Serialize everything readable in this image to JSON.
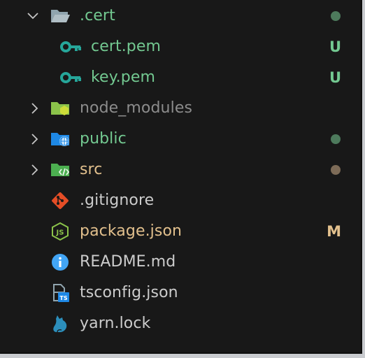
{
  "colors": {
    "background": "#181818",
    "untracked": "#73c991",
    "modified": "#e2c08d",
    "ignored": "#8c8c8c",
    "default": "#cccccc",
    "dot_green": "#4d7a5c",
    "dot_brown": "#7d6b57",
    "key_icon": "#26a69a",
    "git_icon": "#e44d26",
    "info_icon": "#42a5f5",
    "yarn_icon": "#2c8ebb"
  },
  "tree": {
    "cert_folder": {
      "label": ".cert",
      "expanded": true,
      "decoration": "dot",
      "icon": "folder-open-icon"
    },
    "cert_pem": {
      "label": "cert.pem",
      "badge": "U",
      "icon": "key-icon"
    },
    "key_pem": {
      "label": "key.pem",
      "badge": "U",
      "icon": "key-icon"
    },
    "node_modules": {
      "label": "node_modules",
      "expanded": false,
      "icon": "node-folder-icon"
    },
    "public": {
      "label": "public",
      "expanded": false,
      "decoration": "dot",
      "icon": "public-folder-icon"
    },
    "src": {
      "label": "src",
      "expanded": false,
      "decoration": "dot",
      "icon": "src-folder-icon"
    },
    "gitignore": {
      "label": ".gitignore",
      "icon": "git-icon"
    },
    "package_json": {
      "label": "package.json",
      "badge": "M",
      "icon": "nodejs-icon"
    },
    "readme": {
      "label": "README.md",
      "icon": "info-icon"
    },
    "tsconfig": {
      "label": "tsconfig.json",
      "icon": "tsconfig-icon"
    },
    "yarn_lock": {
      "label": "yarn.lock",
      "icon": "yarn-icon"
    }
  }
}
